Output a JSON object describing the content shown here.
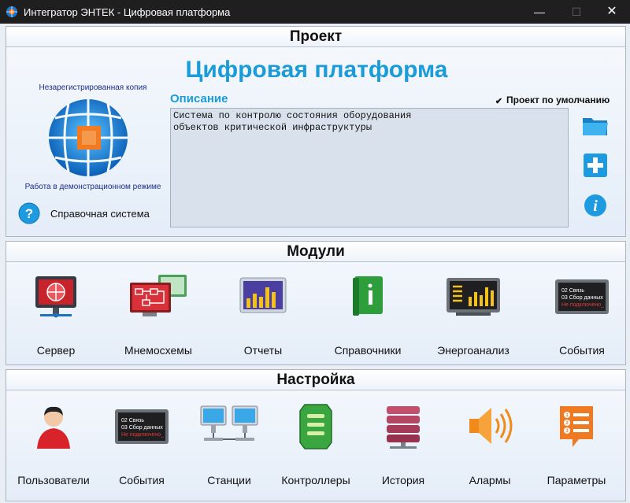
{
  "window": {
    "title": "Интегратор ЭНТЕК - Цифровая платформа",
    "minimize": "—",
    "maximize": "☐",
    "close": "✕"
  },
  "project": {
    "header": "Проект",
    "title": "Цифровая платформа",
    "unregistered": "Незарегистрированная копия",
    "demo_mode": "Работа в демонстрационном режиме",
    "help_label": "Справочная система",
    "description_label": "Описание",
    "default_project_label": "Проект по умолчанию",
    "default_checked": true,
    "description": "Система по контролю состояния оборудования\nобъектов критической инфраструктуры",
    "accent_color": "#1b9bd8"
  },
  "modules": {
    "header": "Модули",
    "items": [
      {
        "label": "Сервер",
        "icon": "server-icon"
      },
      {
        "label": "Мнемосхемы",
        "icon": "mnemonic-icon"
      },
      {
        "label": "Отчеты",
        "icon": "reports-chart-icon"
      },
      {
        "label": "Справочники",
        "icon": "reference-book-icon"
      },
      {
        "label": "Энергоанализ",
        "icon": "energy-analysis-icon"
      },
      {
        "label": "События",
        "icon": "events-screen-icon"
      }
    ],
    "events_screen": {
      "line1": "02 Связь",
      "line2": "03 Сбор данных",
      "line3": "Не подключено_"
    }
  },
  "settings": {
    "header": "Настройка",
    "items": [
      {
        "label": "Пользователи",
        "icon": "user-icon"
      },
      {
        "label": "События",
        "icon": "events-screen-icon"
      },
      {
        "label": "Станции",
        "icon": "stations-icon"
      },
      {
        "label": "Контроллеры",
        "icon": "controller-icon"
      },
      {
        "label": "История",
        "icon": "database-icon"
      },
      {
        "label": "Алармы",
        "icon": "speaker-icon"
      },
      {
        "label": "Параметры",
        "icon": "parameters-icon"
      }
    ],
    "events_screen": {
      "line1": "02 Связь",
      "line2": "03 Сбор данных",
      "line3": "Не подключено_"
    }
  }
}
